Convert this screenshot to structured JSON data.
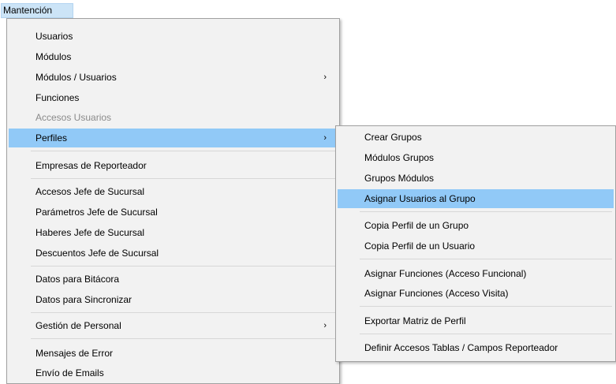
{
  "menubar": {
    "title": "Mantención"
  },
  "main_menu": {
    "items": [
      {
        "label": "Usuarios"
      },
      {
        "label": "Módulos"
      },
      {
        "label": "Módulos / Usuarios",
        "arrow": "›"
      },
      {
        "label": "Funciones"
      },
      {
        "label": "Accesos Usuarios"
      },
      {
        "label": "Perfiles",
        "arrow": "›"
      },
      {
        "label": "Empresas de Reporteador"
      },
      {
        "label": "Accesos Jefe de Sucursal"
      },
      {
        "label": "Parámetros Jefe de Sucursal"
      },
      {
        "label": "Haberes Jefe de Sucursal"
      },
      {
        "label": "Descuentos Jefe de Sucursal"
      },
      {
        "label": "Datos para Bitácora"
      },
      {
        "label": "Datos para Sincronizar"
      },
      {
        "label": "Gestión de Personal",
        "arrow": "›"
      },
      {
        "label": "Mensajes de Error"
      },
      {
        "label": "Envío de Emails"
      }
    ]
  },
  "sub_menu": {
    "items": [
      {
        "label": "Crear Grupos"
      },
      {
        "label": "Módulos Grupos"
      },
      {
        "label": "Grupos Módulos"
      },
      {
        "label": "Asignar Usuarios al Grupo"
      },
      {
        "label": "Copia Perfil de un Grupo"
      },
      {
        "label": "Copia Perfil de un Usuario"
      },
      {
        "label": "Asignar Funciones (Acceso Funcional)"
      },
      {
        "label": "Asignar Funciones (Acceso Visita)"
      },
      {
        "label": "Exportar Matriz de Perfil"
      },
      {
        "label": "Definir Accesos Tablas / Campos Reporteador"
      }
    ]
  },
  "colors": {
    "highlight": "#91c9f7",
    "menu_bg": "#f2f2f2",
    "disabled_text": "#8a8a8a"
  }
}
